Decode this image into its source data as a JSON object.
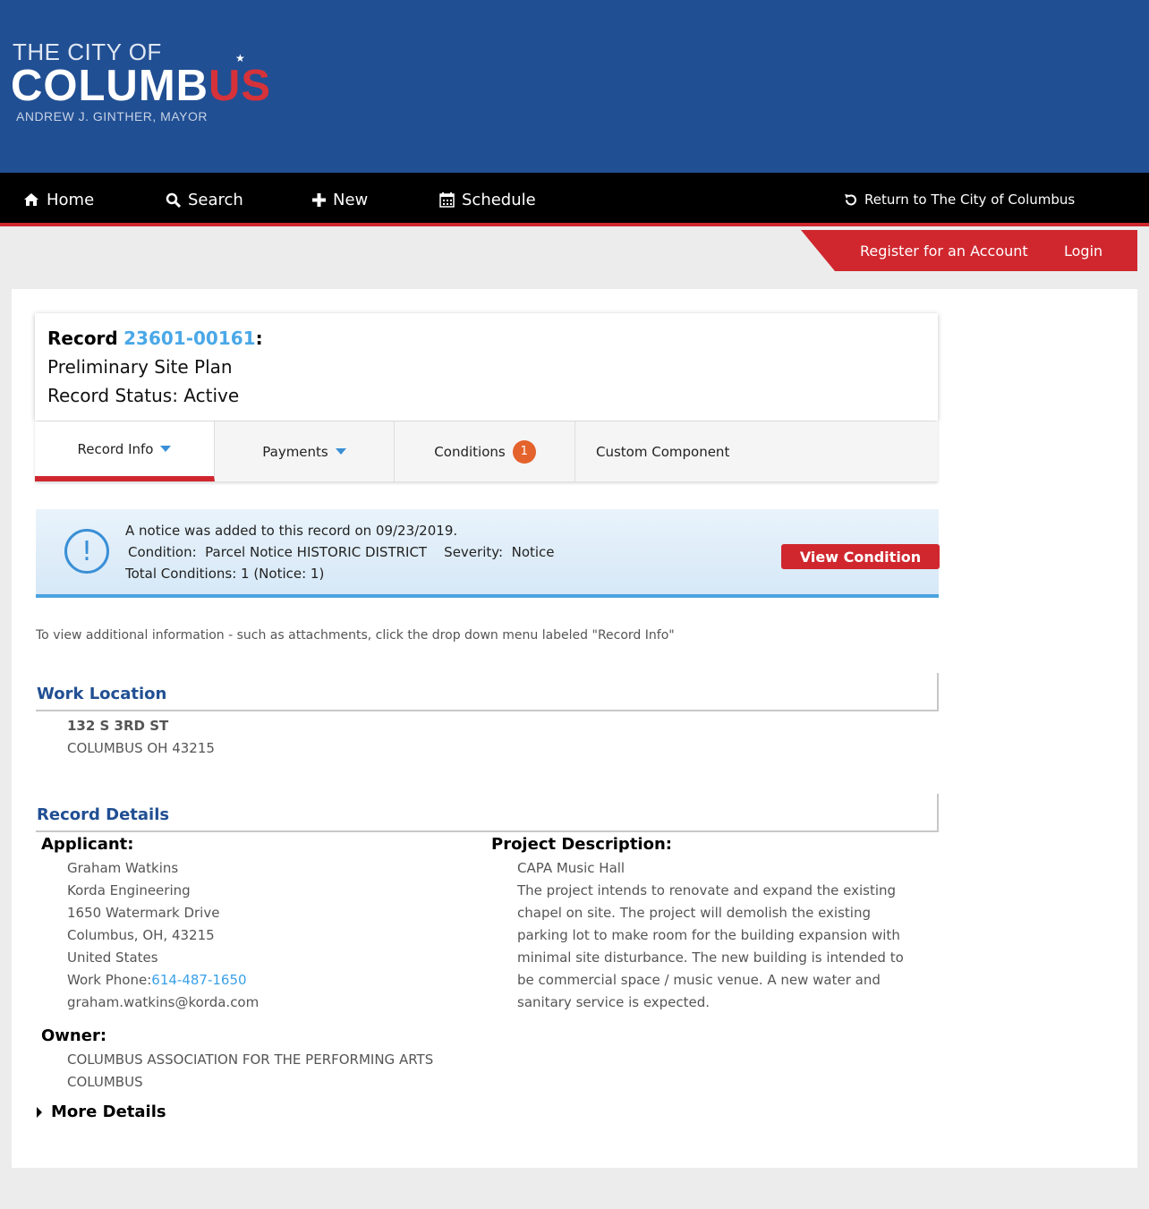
{
  "logo": {
    "line1": "THE CITY OF",
    "line2_main": "COLUMB",
    "line2_accent": "US",
    "line3": "ANDREW J. GINTHER, MAYOR"
  },
  "nav": {
    "home": "Home",
    "search": "Search",
    "new": "New",
    "schedule": "Schedule",
    "return": "Return to The City of Columbus"
  },
  "account": {
    "register": "Register for an Account",
    "login": "Login"
  },
  "record": {
    "label": "Record",
    "number": "23601-00161",
    "colon": ":",
    "type": "Preliminary Site Plan",
    "status": "Record Status: Active"
  },
  "tabs": {
    "record_info": "Record Info",
    "payments": "Payments",
    "conditions": "Conditions",
    "conditions_count": "1",
    "custom": "Custom Component"
  },
  "notice": {
    "line1": "A notice was added to this record on 09/23/2019.",
    "line2": "Condition:  Parcel Notice HISTORIC DISTRICT    Severity:  Notice",
    "line3": "Total Conditions: 1  (Notice: 1)",
    "button": "View Condition"
  },
  "info_text": "To view additional information - such as attachments, click the drop down menu labeled \"Record Info\"",
  "work_location": {
    "heading": "Work Location",
    "address1": "132 S 3RD ST",
    "address2": "COLUMBUS OH 43215"
  },
  "details": {
    "heading": "Record Details",
    "applicant_label": "Applicant:",
    "applicant_name": "Graham Watkins",
    "applicant_company": "Korda Engineering",
    "applicant_street": "1650 Watermark Drive",
    "applicant_city": "Columbus, OH, 43215",
    "applicant_country": "United States",
    "phone_label": "Work Phone:",
    "phone": "614-487-1650",
    "email": "graham.watkins@korda.com",
    "owner_label": "Owner:",
    "owner_name": "COLUMBUS ASSOCIATION FOR THE PERFORMING ARTS",
    "owner_city": "COLUMBUS",
    "project_label": "Project Description:",
    "project_title": "CAPA Music Hall",
    "project_desc_lines": [
      "The project intends to renovate and expand the existing",
      "chapel on site. The project will demolish the existing",
      "parking lot to make room for the building expansion with",
      "minimal site disturbance. The new building is intended to",
      "be commercial space / music venue. A new water and",
      "sanitary service is expected."
    ],
    "more": "More Details"
  },
  "colors": {
    "header_blue": "#214f93",
    "accent_red": "#d0272f",
    "link_blue": "#3aa0e8",
    "badge_orange": "#e4622b"
  }
}
